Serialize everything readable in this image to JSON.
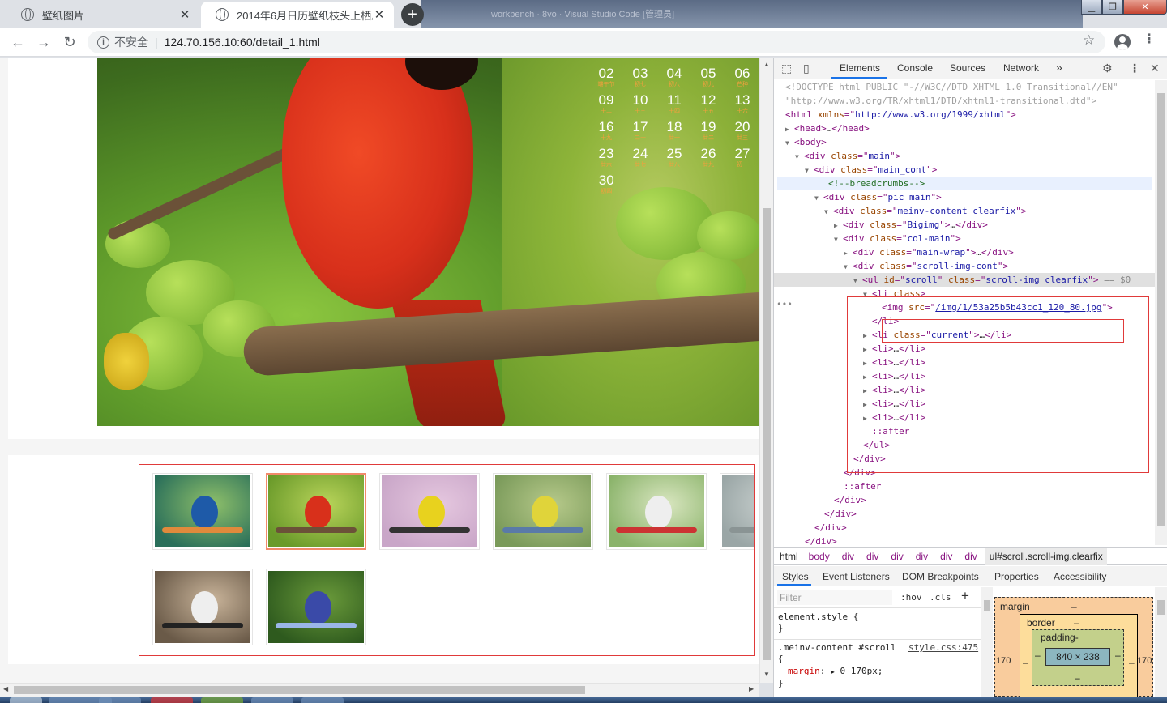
{
  "browser": {
    "tabs": [
      {
        "title": "壁纸图片",
        "active": false
      },
      {
        "title": "2014年6月日历壁纸枝头上栖息的",
        "active": true
      }
    ],
    "new_tab": "+",
    "window_caption": "workbench · 8vo · Visual Studio Code [管理员]",
    "address": {
      "security_label": "不安全",
      "url": "124.70.156.10:60/detail_1.html"
    }
  },
  "page": {
    "calendar": {
      "weeks": [
        [
          {
            "d": "02",
            "n": "端午节"
          },
          {
            "d": "03",
            "n": "初七"
          },
          {
            "d": "04",
            "n": "初八"
          },
          {
            "d": "05",
            "n": "初九"
          },
          {
            "d": "06",
            "n": "芒种"
          }
        ],
        [
          {
            "d": "09",
            "n": "十二"
          },
          {
            "d": "10",
            "n": "十三"
          },
          {
            "d": "11",
            "n": "十四"
          },
          {
            "d": "12",
            "n": "十五"
          },
          {
            "d": "13",
            "n": "十六"
          }
        ],
        [
          {
            "d": "16",
            "n": "十九"
          },
          {
            "d": "17",
            "n": "二十"
          },
          {
            "d": "18",
            "n": "廿一"
          },
          {
            "d": "19",
            "n": "廿二"
          },
          {
            "d": "20",
            "n": "廿三"
          }
        ],
        [
          {
            "d": "23",
            "n": "廿六"
          },
          {
            "d": "24",
            "n": "廿七"
          },
          {
            "d": "25",
            "n": "廿八"
          },
          {
            "d": "26",
            "n": "廿九"
          },
          {
            "d": "27",
            "n": "初一"
          }
        ],
        [
          {
            "d": "30",
            "n": "初四"
          }
        ]
      ]
    },
    "thumbnails": [
      {
        "name": "kingfisher",
        "current": false
      },
      {
        "name": "cardinal",
        "current": true
      },
      {
        "name": "grosbeak",
        "current": false
      },
      {
        "name": "warbler",
        "current": false
      },
      {
        "name": "chickadee-blossom",
        "current": false
      },
      {
        "name": "mist",
        "current": false
      },
      {
        "name": "chickadee-hand",
        "current": false
      },
      {
        "name": "hummingbird",
        "current": false
      }
    ]
  },
  "devtools": {
    "tabs": [
      "Elements",
      "Console",
      "Sources",
      "Network"
    ],
    "more": "»",
    "dom": {
      "doctype1": "<!DOCTYPE html PUBLIC \"-//W3C//DTD XHTML 1.0 Transitional//EN\"",
      "doctype2": "\"http://www.w3.org/TR/xhtml1/DTD/xhtml1-transitional.dtd\">",
      "html_xmlns": "http://www.w3.org/1999/xhtml",
      "comment": "<!--breadcrumbs-->",
      "img_src": "/img/1/53a25b5b43cc1_120_80.jpg",
      "selected_marker": "== $0"
    },
    "breadcrumbs": [
      "html",
      "body",
      "div",
      "div",
      "div",
      "div",
      "div",
      "div",
      "ul#scroll.scroll-img.clearfix"
    ],
    "subtabs": [
      "Styles",
      "Event Listeners",
      "DOM Breakpoints",
      "Properties",
      "Accessibility"
    ],
    "styles": {
      "filter_placeholder": "Filter",
      "hov": ":hov",
      "cls": ".cls",
      "element_style": "element.style {",
      "close_brace": "}",
      "rule_selector": ".meinv-content #scroll",
      "rule_source": "style.css:475",
      "open_brace": "{",
      "prop_name": "margin",
      "prop_value": "0 170px;"
    },
    "box_model": {
      "margin_label": "margin",
      "border_label": "border",
      "padding_label": "padding-",
      "dash": "–",
      "margin_left": "170",
      "margin_right": "170",
      "content_size": "840 × 238"
    }
  },
  "colors": {
    "highlight_red": "#e03a3a",
    "devtools_accent": "#1a73e8",
    "calendar_accent": "#f2a03d"
  }
}
